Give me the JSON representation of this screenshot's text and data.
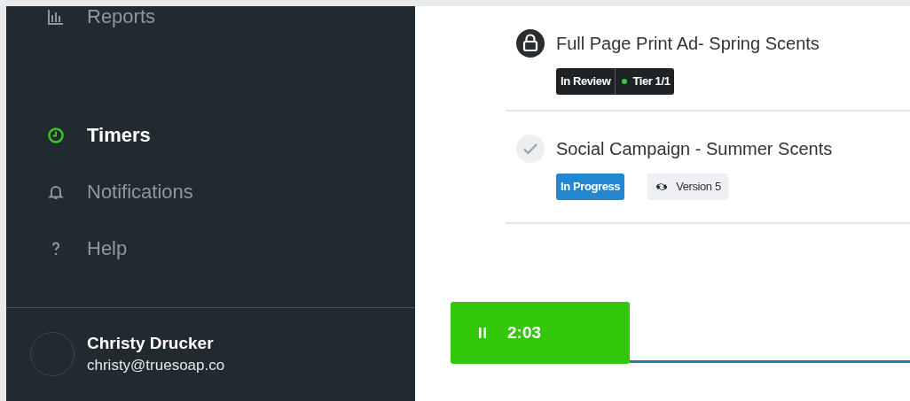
{
  "sidebar": {
    "items": [
      {
        "label": "Reports",
        "kind": "chart",
        "selected": false
      },
      {
        "label": "Timers",
        "kind": "clock",
        "selected": true
      },
      {
        "label": "Notifications",
        "kind": "bell",
        "selected": false
      },
      {
        "label": "Help",
        "kind": "question",
        "selected": false
      }
    ],
    "user": {
      "name": "Christy Drucker",
      "email": "christy@truesoap.co"
    }
  },
  "tasks": [
    {
      "title": "Full Page Print Ad- Spring Scents",
      "kind": "locked",
      "tags": [
        {
          "kind": "status",
          "label": "In Review",
          "color": "#1f2326"
        },
        {
          "kind": "tier",
          "label": "Tier 1/1",
          "color": "#2ecc40"
        }
      ]
    },
    {
      "title": "Social Campaign - Summer Scents",
      "kind": "done",
      "tags": [
        {
          "kind": "status",
          "label": "In Progress",
          "color": "#2386d1"
        },
        {
          "kind": "version",
          "label": "Version 5"
        }
      ]
    }
  ],
  "timer": {
    "time": "2:03",
    "running": true
  }
}
